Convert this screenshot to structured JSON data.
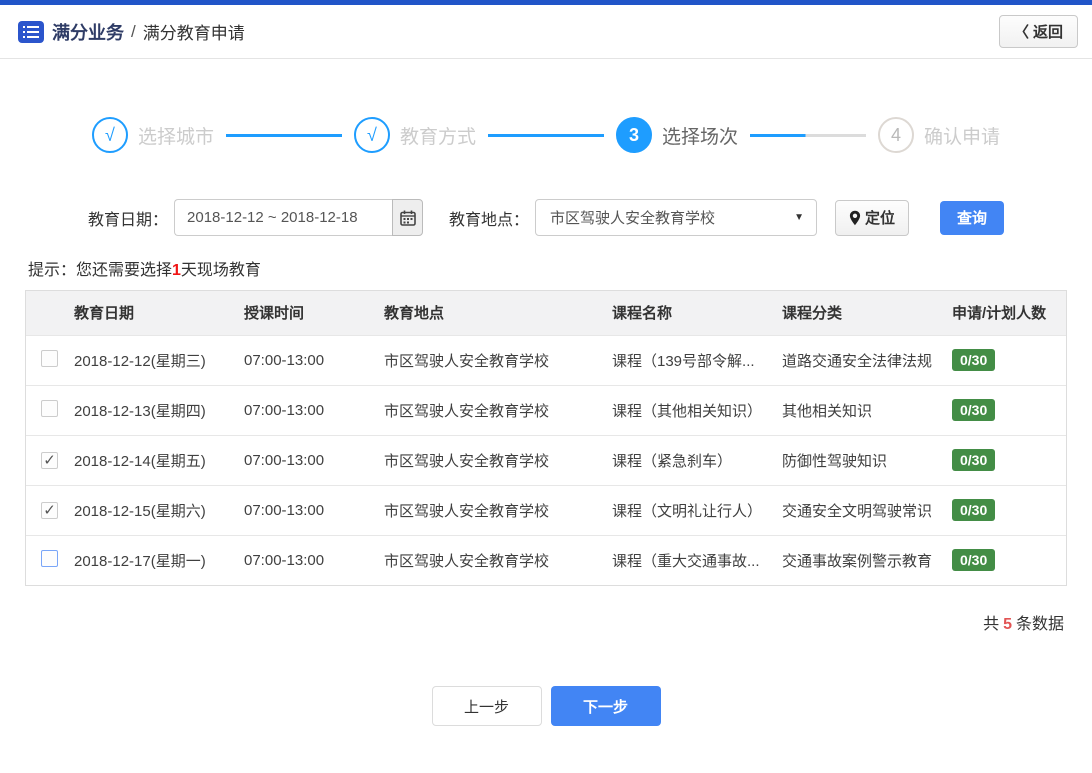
{
  "header": {
    "breadcrumb_section": "满分业务",
    "breadcrumb_separator": "/",
    "breadcrumb_page": "满分教育申请",
    "back_chevron": "〈",
    "back_label": "返回"
  },
  "steps": [
    {
      "symbol": "√",
      "label": "选择城市",
      "state": "done"
    },
    {
      "symbol": "√",
      "label": "教育方式",
      "state": "done"
    },
    {
      "symbol": "3",
      "label": "选择场次",
      "state": "current"
    },
    {
      "symbol": "4",
      "label": "确认申请",
      "state": "pending"
    }
  ],
  "filters": {
    "date_label": "教育日期：",
    "date_value": "2018-12-12 ~ 2018-12-18",
    "location_label": "教育地点：",
    "location_value": "市区驾驶人安全教育学校",
    "dropdown_arrow": "▼",
    "locate_button": "定位",
    "search_button": "查询"
  },
  "hint": {
    "prefix": "提示：您还需要选择",
    "highlight": "1",
    "suffix": "天现场教育"
  },
  "table": {
    "headers": [
      "教育日期",
      "授课时间",
      "教育地点",
      "课程名称",
      "课程分类",
      "申请/计划人数"
    ],
    "rows": [
      {
        "checked": false,
        "focus": false,
        "date": "2018-12-12(星期三)",
        "time": "07:00-13:00",
        "place": "市区驾驶人安全教育学校",
        "course": "课程（139号部令解...",
        "category": "道路交通安全法律法规",
        "quota": "0/30"
      },
      {
        "checked": false,
        "focus": false,
        "date": "2018-12-13(星期四)",
        "time": "07:00-13:00",
        "place": "市区驾驶人安全教育学校",
        "course": "课程（其他相关知识）",
        "category": "其他相关知识",
        "quota": "0/30"
      },
      {
        "checked": true,
        "focus": false,
        "date": "2018-12-14(星期五)",
        "time": "07:00-13:00",
        "place": "市区驾驶人安全教育学校",
        "course": "课程（紧急刹车）",
        "category": "防御性驾驶知识",
        "quota": "0/30"
      },
      {
        "checked": true,
        "focus": false,
        "date": "2018-12-15(星期六)",
        "time": "07:00-13:00",
        "place": "市区驾驶人安全教育学校",
        "course": "课程（文明礼让行人）",
        "category": "交通安全文明驾驶常识",
        "quota": "0/30"
      },
      {
        "checked": false,
        "focus": true,
        "date": "2018-12-17(星期一)",
        "time": "07:00-13:00",
        "place": "市区驾驶人安全教育学校",
        "course": "课程（重大交通事故...",
        "category": "交通事故案例警示教育",
        "quota": "0/30"
      }
    ]
  },
  "summary": {
    "prefix": "共",
    "count": "5",
    "suffix": "条数据"
  },
  "footer": {
    "prev_button": "上一步",
    "next_button": "下一步"
  },
  "icons": {
    "breadcrumb": "list-icon",
    "back": "chevron-left-icon",
    "date_picker": "calendar-icon",
    "location": "location-pin-icon",
    "select": "dropdown-arrow-icon"
  },
  "colors": {
    "top_bar_blue": "#2155c8",
    "accent_blue": "#4285f4",
    "step_blue": "#1e9dff",
    "badge_green": "#438d46",
    "hint_red": "#f01414",
    "count_red": "#e25454"
  }
}
